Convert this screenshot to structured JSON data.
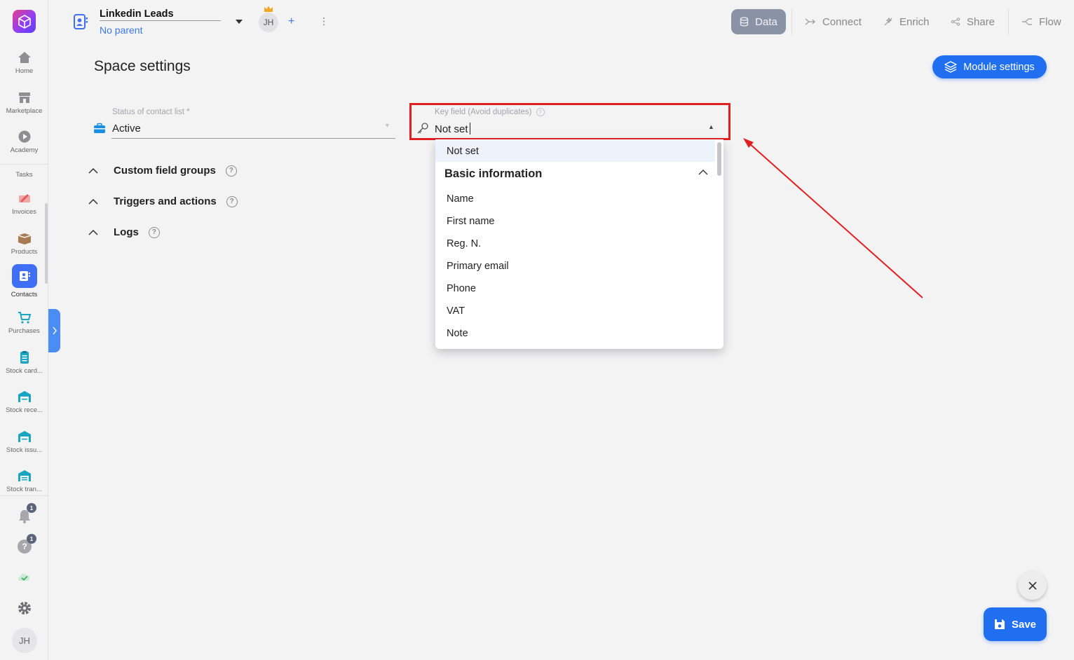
{
  "sidebar": {
    "items": [
      {
        "label": "Home",
        "icon": "home-icon"
      },
      {
        "label": "Marketplace",
        "icon": "store-icon"
      },
      {
        "label": "Academy",
        "icon": "play-icon"
      },
      {
        "label": "Tasks",
        "icon": "tasks-icon"
      },
      {
        "label": "Invoices",
        "icon": "invoice-icon"
      },
      {
        "label": "Products",
        "icon": "box-icon"
      },
      {
        "label": "Contacts",
        "icon": "contacts-icon"
      },
      {
        "label": "Purchases",
        "icon": "cart-icon"
      },
      {
        "label": "Stock card...",
        "icon": "clipboard-icon"
      },
      {
        "label": "Stock rece...",
        "icon": "warehouse-icon"
      },
      {
        "label": "Stock issu...",
        "icon": "warehouse-icon"
      },
      {
        "label": "Stock tran...",
        "icon": "warehouse-icon"
      }
    ],
    "notifications_badge": "1",
    "help_badge": "1",
    "user_initials": "JH"
  },
  "header": {
    "space_name": "Linkedin Leads",
    "parent": "No parent",
    "owner_initials": "JH",
    "tabs": [
      {
        "label": "Data",
        "icon": "database-icon",
        "active": true
      },
      {
        "label": "Connect",
        "icon": "connect-icon"
      },
      {
        "label": "Enrich",
        "icon": "enrich-icon"
      },
      {
        "label": "Share",
        "icon": "share-icon"
      },
      {
        "label": "Flow",
        "icon": "flow-icon"
      }
    ]
  },
  "main": {
    "title": "Space settings",
    "module_settings_label": "Module settings",
    "status_field": {
      "label": "Status of contact list *",
      "value": "Active"
    },
    "key_field": {
      "label": "Key field (Avoid duplicates)",
      "value": "Not set"
    },
    "sections": [
      "Custom field groups",
      "Triggers and actions",
      "Logs"
    ]
  },
  "dropdown": {
    "selected": "Not set",
    "group": "Basic information",
    "options": [
      "Name",
      "First name",
      "Reg. N.",
      "Primary email",
      "Phone",
      "VAT",
      "Note"
    ]
  },
  "actions": {
    "save_label": "Save"
  },
  "colors": {
    "accent": "#1f6ff0",
    "highlight": "#e02020",
    "active_tab": "#8a93a6"
  }
}
